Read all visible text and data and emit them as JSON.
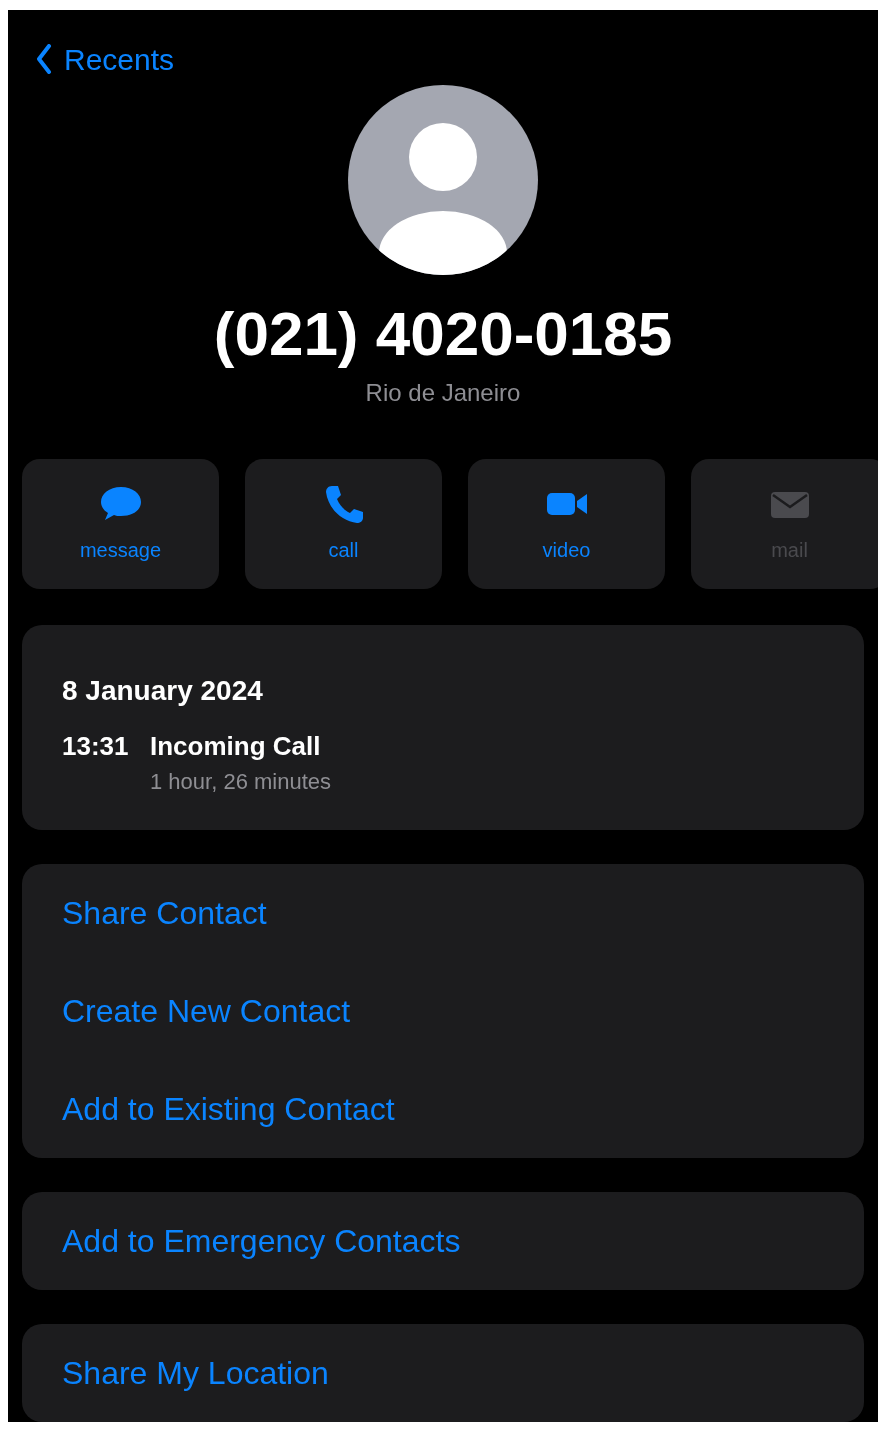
{
  "nav": {
    "back_label": "Recents"
  },
  "contact": {
    "phone": "(021) 4020-0185",
    "subtitle": "Rio de Janeiro"
  },
  "actions": [
    {
      "kind": "message",
      "label": "message",
      "disabled": false
    },
    {
      "kind": "call",
      "label": "call",
      "disabled": false
    },
    {
      "kind": "video",
      "label": "video",
      "disabled": false
    },
    {
      "kind": "mail",
      "label": "mail",
      "disabled": true
    }
  ],
  "call_log": {
    "date": "8 January 2024",
    "entries": [
      {
        "time": "13:31",
        "type": "Incoming Call",
        "duration": "1 hour, 26 minutes"
      }
    ]
  },
  "groups": [
    {
      "items": [
        "Share Contact",
        "Create New Contact",
        "Add to Existing Contact"
      ]
    },
    {
      "items": [
        "Add to Emergency Contacts"
      ]
    },
    {
      "items": [
        "Share My Location"
      ]
    }
  ]
}
